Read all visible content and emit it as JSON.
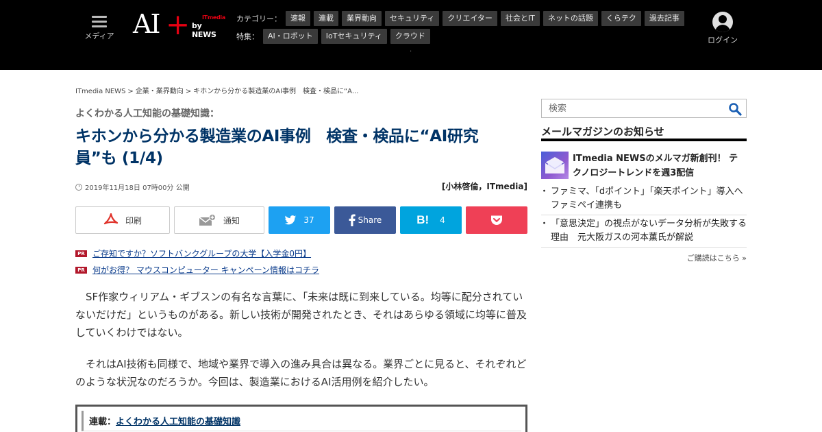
{
  "header": {
    "menu_label": "メディア",
    "logo": {
      "ai": "AI",
      "plus": "+",
      "itmedia": "ITmedia",
      "by": "by NEWS"
    },
    "category_label": "カテゴリー：",
    "categories": [
      "速報",
      "連載",
      "業界動向",
      "セキュリティ",
      "クリエイター",
      "社会とIT",
      "ネットの話題",
      "くらテク",
      "過去記事"
    ],
    "feature_label": "特集：",
    "features": [
      "AI・ロボット",
      "IoTセキュリティ",
      "クラウド"
    ],
    "dot": "·",
    "login_label": "ログイン"
  },
  "breadcrumb": [
    "ITmedia NEWS",
    "企業・業界動向",
    "キホンから分かる製造業のAI事例　検査・検品に“A..."
  ],
  "breadcrumb_sep": ">",
  "article": {
    "kicker": "よくわかる人工知能の基礎知識：",
    "title": "キホンから分かる製造業のAI事例　検査・検品に“AI研究員”も (1/4)",
    "date": "2019年11月18日 07時00分 公開",
    "author": "[小林啓倫，ITmedia]",
    "share": {
      "print": "印刷",
      "notify": "通知",
      "twitter_count": "37",
      "facebook": "Share",
      "hatena_count": "4"
    },
    "pr_badge": "PR",
    "pr_links": [
      "ご存知ですか？ソフトバンクグループの大学【入学金0円】",
      "何がお得？ マウスコンピューター キャンペーン情報はコチラ"
    ],
    "paragraphs": [
      "SF作家ウィリアム・ギブスンの有名な言葉に、「未来は既に到来している。均等に配分されていないだけだ」というものがある。新しい技術が開発されたとき、それはあらゆる領域に均等に普及していくわけではない。",
      "それはAI技術も同様で、地域や業界で導入の進み具合は異なる。業界ごとに見ると、それぞれどのような状況なのだろうか。今回は、製造業におけるAI活用例を紹介したい。"
    ],
    "series_label": "連載：",
    "series_link": "よくわかる人工知能の基礎知識"
  },
  "sidebar": {
    "search_placeholder": "検索",
    "mailmag_heading": "メールマガジンのお知らせ",
    "feature_title": "ITmedia NEWSのメルマガ新創刊！ テクノロジートレンドを週3配信",
    "items": [
      "ファミマ、「dポイント」「楽天ポイント」導入へ　ファミペイ連携も",
      "「意思決定」の視点がないデータ分析が失敗する理由　元大阪ガスの河本薫氏が解説"
    ],
    "more_link": "ご購読はこちら »"
  },
  "colors": {
    "header_bg": "#000000",
    "title": "#003366",
    "twitter": "#1da1f2",
    "facebook": "#3b5998",
    "hatena": "#00a4de",
    "pocket": "#ef4056",
    "pr_badge": "#b2182b",
    "logo_plus": "#e60012"
  }
}
